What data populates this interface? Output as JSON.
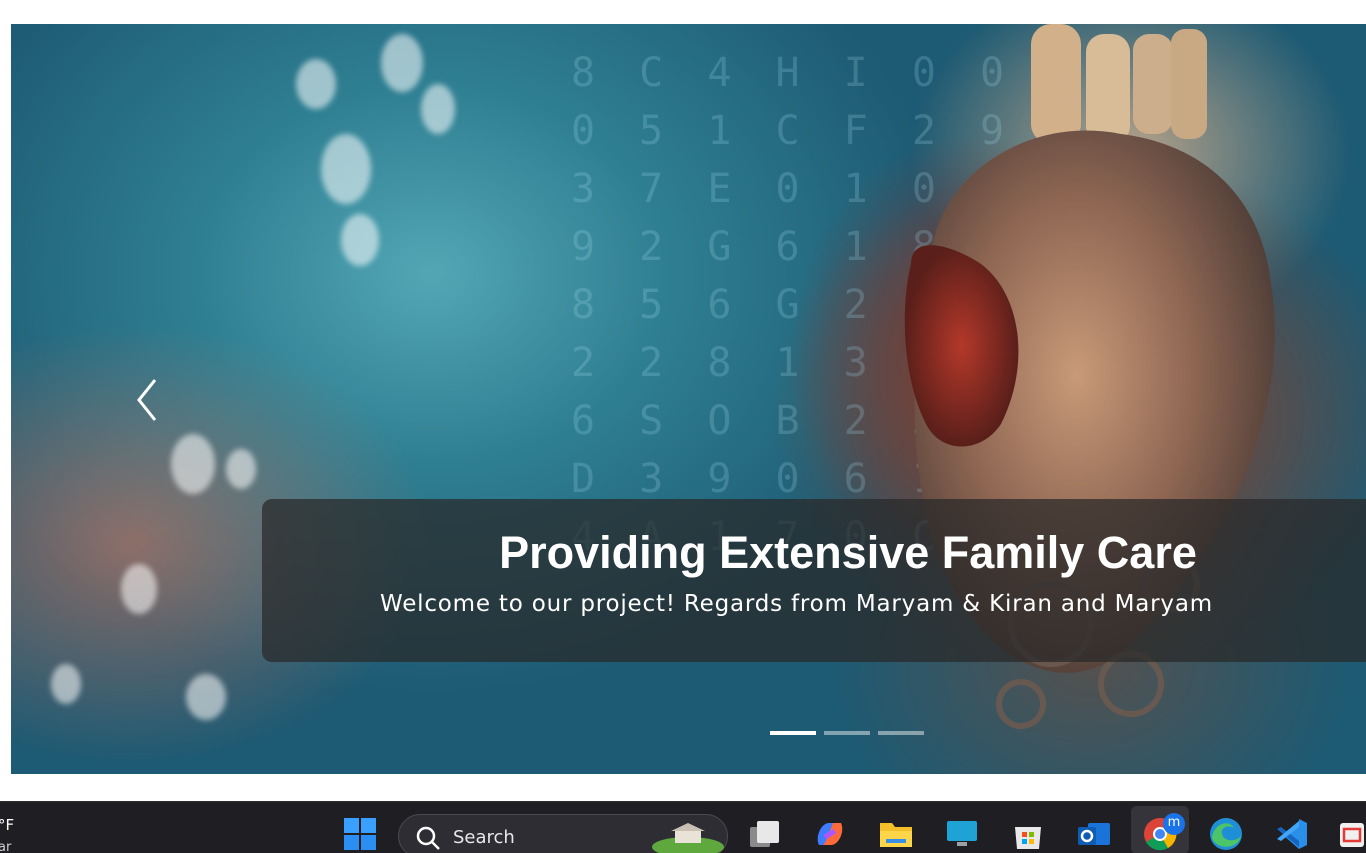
{
  "carousel": {
    "caption_title": "Providing Extensive Family Care",
    "caption_subtitle": "Welcome to our project! Regards from Maryam & Kiran and Maryam",
    "prev_arrow_icon": "chevron-left-icon",
    "background_text": "8 C 4 H I 0 0 2\n0 5 1 C F 2 9 6\n3 7 E 0 1 0 7 A\n9 2 G 6 1 8 V 3\n8 5 6 G 2 0 H 8\n2 2 8 1 3 0 B 6\n6 S O B 2 5 A 4\nD 3 9 0 6 1 E 9\n4 A 1 7 0 C 8 2",
    "indicators": [
      {
        "label": "Slide 1",
        "active": true
      },
      {
        "label": "Slide 2",
        "active": false
      },
      {
        "label": "Slide 3",
        "active": false
      }
    ]
  },
  "taskbar": {
    "weather": {
      "temp": "°F",
      "condition": "ar"
    },
    "search": {
      "label": "Search"
    },
    "icons": [
      {
        "name": "windows-start-icon"
      },
      {
        "name": "search-icon"
      },
      {
        "name": "task-view-icon"
      },
      {
        "name": "copilot-icon"
      },
      {
        "name": "file-explorer-icon"
      },
      {
        "name": "remote-desktop-icon"
      },
      {
        "name": "microsoft-store-icon"
      },
      {
        "name": "outlook-icon"
      },
      {
        "name": "chrome-icon",
        "badge": "m"
      },
      {
        "name": "edge-icon"
      },
      {
        "name": "vscode-icon"
      },
      {
        "name": "snipping-tool-icon"
      }
    ]
  },
  "colors": {
    "taskbar_bg": "#1f1f23",
    "caption_bg": "rgba(40,40,40,0.72)",
    "chrome_badge": "#1a73e8"
  }
}
